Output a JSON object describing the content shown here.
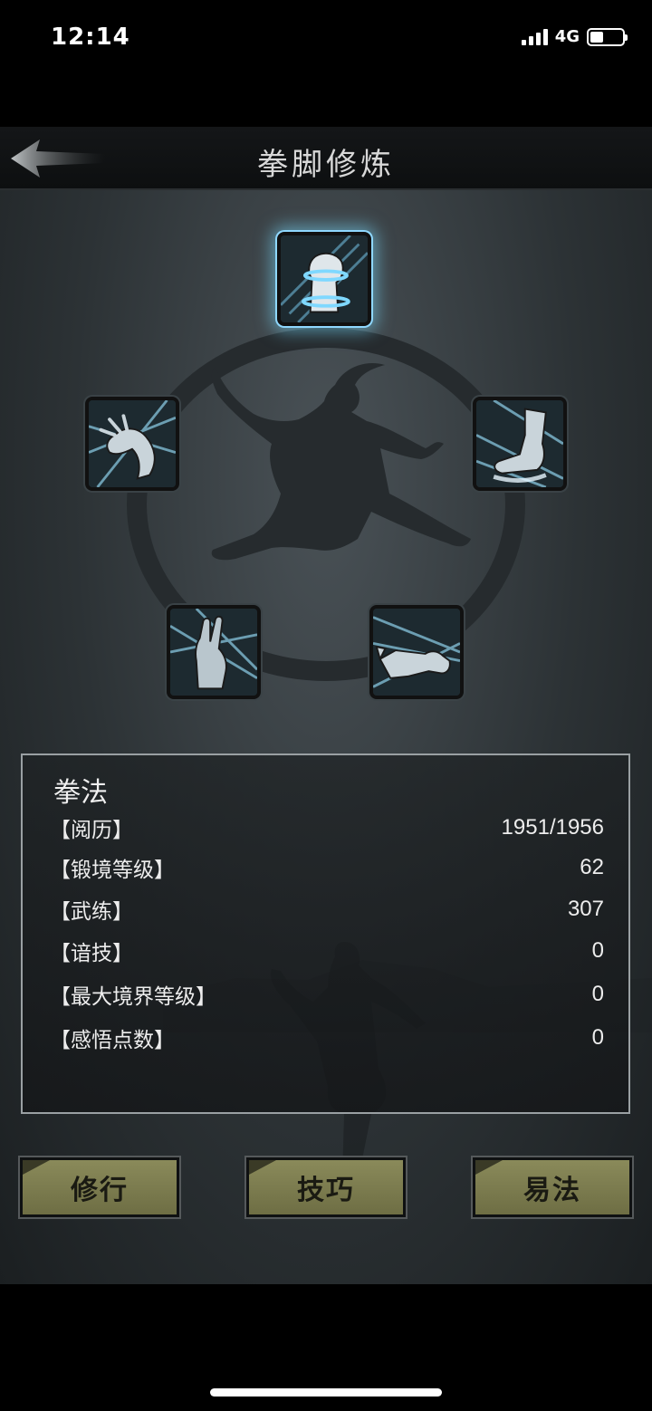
{
  "status_bar": {
    "time": "12:14",
    "network": "4G"
  },
  "header": {
    "title": "拳脚修炼"
  },
  "skills": [
    {
      "icon": "fist-icon",
      "selected": true
    },
    {
      "icon": "claw-icon",
      "selected": false
    },
    {
      "icon": "foot-kick-icon",
      "selected": false
    },
    {
      "icon": "palm-icon",
      "selected": false
    },
    {
      "icon": "finger-strike-icon",
      "selected": false
    }
  ],
  "panel": {
    "title": "拳法",
    "stats": [
      {
        "label": "【阅历】",
        "value": "1951/1956"
      },
      {
        "label": "【锻境等级】",
        "value": "62"
      },
      {
        "label": "【武练】",
        "value": "307"
      },
      {
        "label": "【谙技】",
        "value": "0"
      },
      {
        "label": "【最大境界等级】",
        "value": "0"
      },
      {
        "label": "【感悟点数】",
        "value": "0"
      }
    ]
  },
  "buttons": {
    "practice": "修行",
    "technique": "技巧",
    "change_method": "易法"
  },
  "colors": {
    "highlight": "#8fd8ff",
    "button": "#7c7c4e"
  }
}
